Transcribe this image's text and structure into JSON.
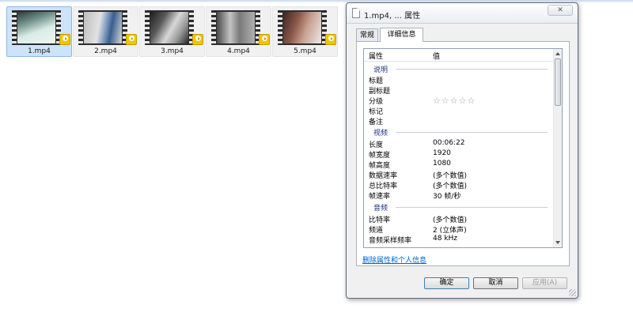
{
  "files": [
    {
      "name": "1.mp4",
      "selected": true,
      "thumb": [
        "#6f8f8a",
        "#d9ece6",
        "#3c4a47"
      ]
    },
    {
      "name": "2.mp4",
      "selected": false,
      "thumb": [
        "#9a9a9a",
        "#dcdcdc",
        "#3a5e8f"
      ]
    },
    {
      "name": "3.mp4",
      "selected": false,
      "thumb": [
        "#6b6b6b",
        "#cfcfcf",
        "#202020"
      ]
    },
    {
      "name": "4.mp4",
      "selected": false,
      "thumb": [
        "#7d7d7d",
        "#b9b9b9",
        "#4a4a4a"
      ]
    },
    {
      "name": "5.mp4",
      "selected": false,
      "thumb": [
        "#5a3a32",
        "#c9a090",
        "#e8e8e8"
      ]
    }
  ],
  "dialog": {
    "title": "1.mp4, ... 属性",
    "close_label": "✕",
    "tabs": [
      "常规",
      "详细信息"
    ],
    "header": {
      "property": "属性",
      "value": "值"
    },
    "groups": [
      {
        "name": "说明",
        "rows": [
          {
            "k": "标题",
            "v": ""
          },
          {
            "k": "副标题",
            "v": ""
          },
          {
            "k": "分级",
            "v": "☆☆☆☆☆"
          },
          {
            "k": "标记",
            "v": ""
          },
          {
            "k": "备注",
            "v": ""
          }
        ]
      },
      {
        "name": "视频",
        "rows": [
          {
            "k": "长度",
            "v": "00:06:22"
          },
          {
            "k": "帧宽度",
            "v": "1920"
          },
          {
            "k": "帧高度",
            "v": "1080"
          },
          {
            "k": "数据速率",
            "v": "(多个数值)"
          },
          {
            "k": "总比特率",
            "v": "(多个数值)"
          },
          {
            "k": "帧速率",
            "v": "30 帧/秒"
          }
        ]
      },
      {
        "name": "音频",
        "rows": [
          {
            "k": "比特率",
            "v": "(多个数值)"
          },
          {
            "k": "频道",
            "v": "2 (立体声)"
          },
          {
            "k": "音频采样频率",
            "v": "48 kHz"
          }
        ]
      }
    ],
    "remove_link": "删除属性和个人信息",
    "buttons": {
      "ok": "确定",
      "cancel": "取消",
      "apply": "应用(A)"
    }
  }
}
